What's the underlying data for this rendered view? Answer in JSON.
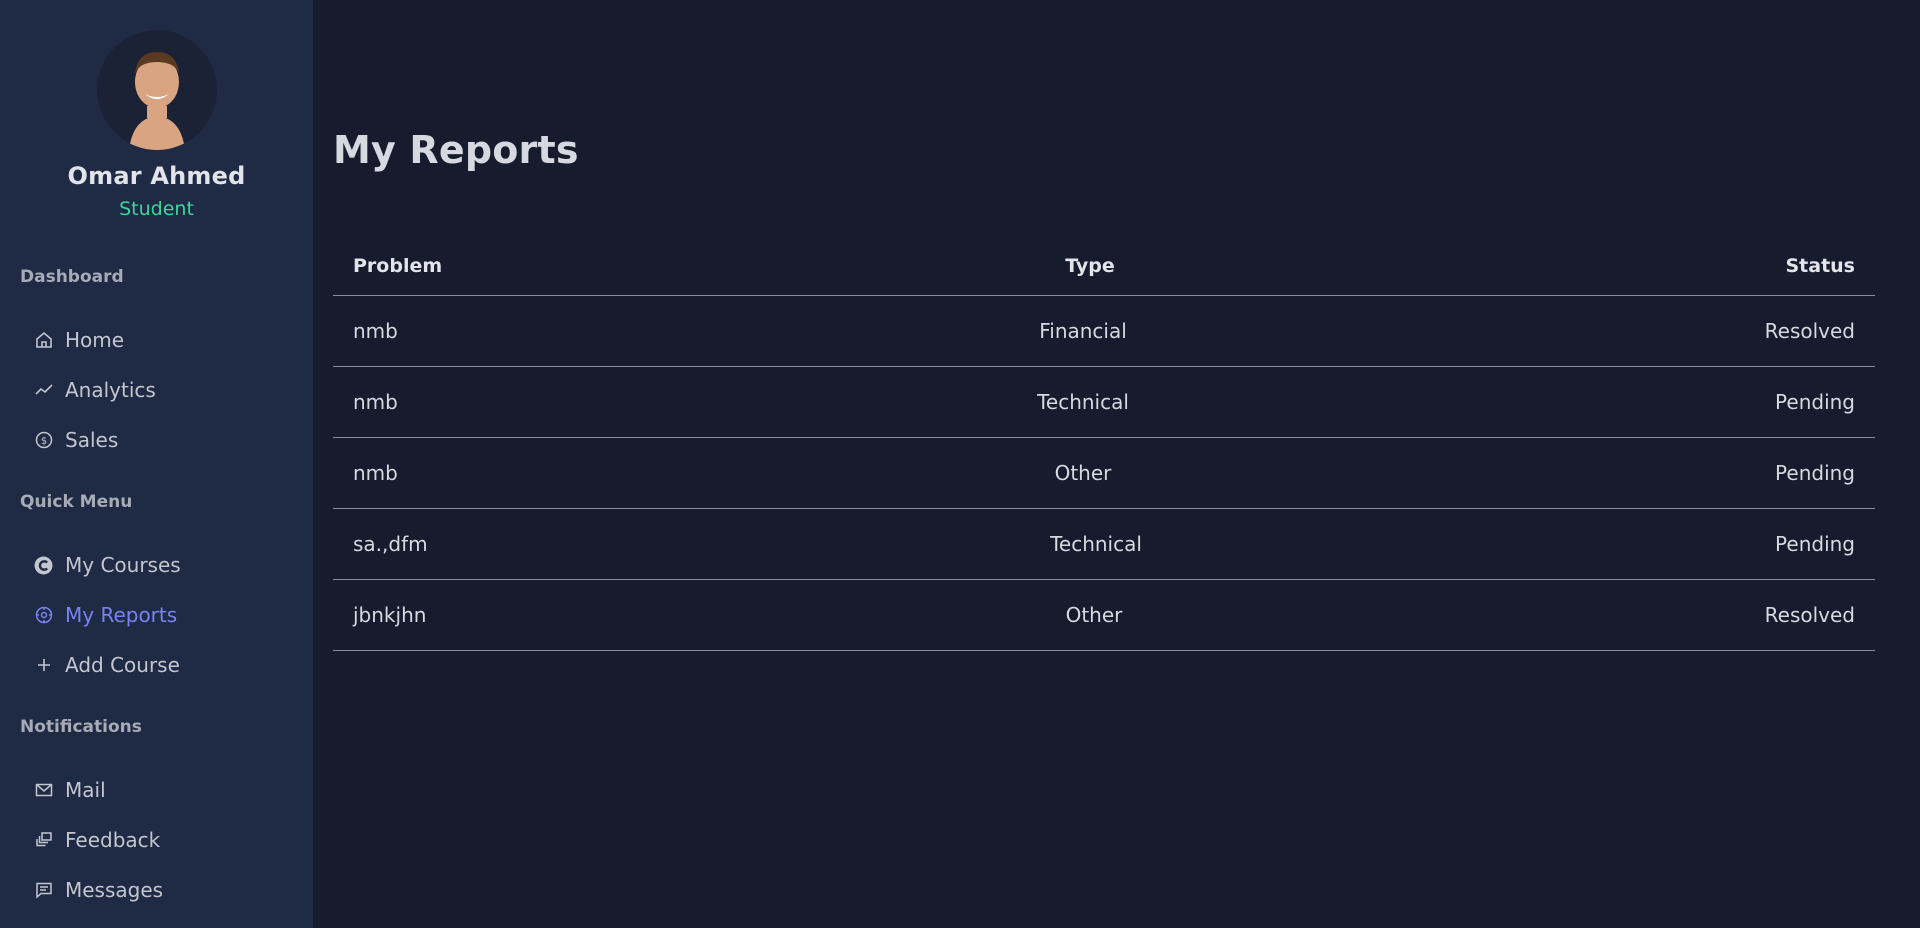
{
  "profile": {
    "name": "Omar Ahmed",
    "role": "Student"
  },
  "sections": {
    "dashboard": "Dashboard",
    "quick_menu": "Quick Menu",
    "notifications": "Notifications"
  },
  "nav": {
    "home": "Home",
    "analytics": "Analytics",
    "sales": "Sales",
    "my_courses": "My Courses",
    "my_reports": "My Reports",
    "add_course": "Add Course",
    "mail": "Mail",
    "feedback": "Feedback",
    "messages": "Messages"
  },
  "page": {
    "title": "My Reports"
  },
  "table": {
    "headers": [
      "Problem",
      "Type",
      "Status"
    ],
    "rows": [
      [
        "nmb",
        "Financial",
        "Resolved"
      ],
      [
        "nmb",
        "Technical",
        "Pending"
      ],
      [
        "nmb",
        "Other",
        "Pending"
      ],
      [
        "sa.,dfm",
        "Technical",
        "Pending"
      ],
      [
        "jbnkjhn",
        "Other",
        "Resolved"
      ]
    ]
  },
  "colors": {
    "sidebar_bg": "#1f2a44",
    "main_bg": "#161c2d",
    "active": "#7b82f0",
    "role": "#3fd49c"
  }
}
